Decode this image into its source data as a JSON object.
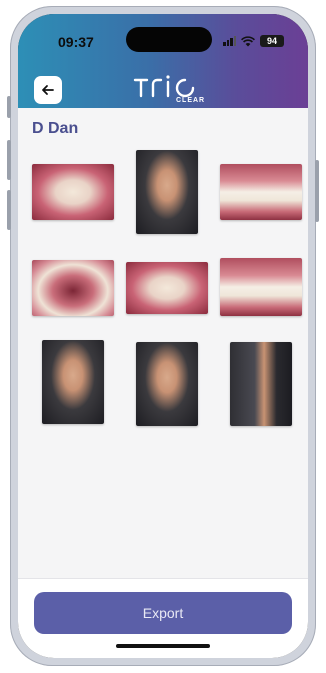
{
  "status_bar": {
    "time": "09:37",
    "battery": "94"
  },
  "header": {
    "logo_text": "TRIO",
    "logo_subtext": "CLEAR",
    "gradient": [
      "#2d8fb6",
      "#6b3f95"
    ]
  },
  "patient": {
    "name": "D Dan"
  },
  "photos": [
    {
      "name": "upper-occlusal-photo",
      "kind": "mouth"
    },
    {
      "name": "frontal-face-photo",
      "kind": "face"
    },
    {
      "name": "right-buccal-photo",
      "kind": "side"
    },
    {
      "name": "lower-occlusal-photo",
      "kind": "open"
    },
    {
      "name": "frontal-intraoral-photo",
      "kind": "mouth"
    },
    {
      "name": "left-buccal-photo",
      "kind": "side"
    },
    {
      "name": "three-quarter-smile-photo",
      "kind": "face"
    },
    {
      "name": "frontal-smile-photo",
      "kind": "face"
    },
    {
      "name": "profile-photo",
      "kind": "profile"
    }
  ],
  "actions": {
    "export_label": "Export"
  },
  "colors": {
    "accent": "#5b5fa8",
    "title": "#4a4f8f"
  }
}
